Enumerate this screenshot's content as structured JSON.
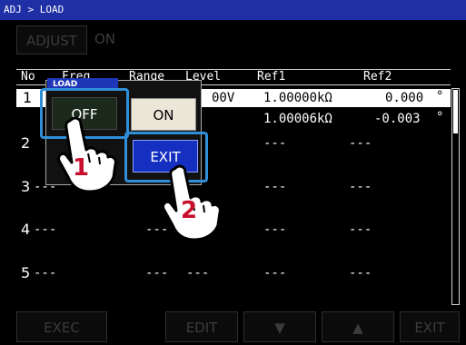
{
  "title": "ADJ > LOAD",
  "adjust": {
    "label": "ADJUST",
    "value": "ON"
  },
  "table": {
    "headers": [
      "No",
      "Freq",
      "Range",
      "Level",
      "Ref1",
      "Ref2"
    ],
    "rows": [
      {
        "no": "1",
        "level": "00V",
        "ref1": "1.00000kΩ",
        "ref2": "0.000",
        "unit": "°"
      },
      {
        "no": "",
        "ref1": "1.00006kΩ",
        "ref2": "-0.003",
        "unit": "°"
      },
      {
        "no": "2",
        "ref1": "---",
        "ref2": "---"
      },
      {
        "no": "3",
        "freq": "---",
        "ref1": "---",
        "ref2": "---"
      },
      {
        "no": "4",
        "freq": "---",
        "range": "---",
        "ref1": "---",
        "ref2": "---"
      },
      {
        "no": "5",
        "freq": "---",
        "range": "---",
        "level": "---",
        "ref1": "---",
        "ref2": "---"
      }
    ]
  },
  "popup": {
    "title": "LOAD",
    "off_label": "OFF",
    "on_label": "ON",
    "exit_label": "EXIT"
  },
  "badges": {
    "step1": "1",
    "step2": "2"
  },
  "bottom": {
    "exec": "EXEC",
    "edit": "EDIT",
    "down": "▼",
    "up": "▲",
    "exit": "EXIT"
  },
  "colors": {
    "titlebar": "#1f2fa6",
    "highlight": "#2f8fd8",
    "badge": "#c8102e",
    "exit_key": "#1530c0"
  }
}
